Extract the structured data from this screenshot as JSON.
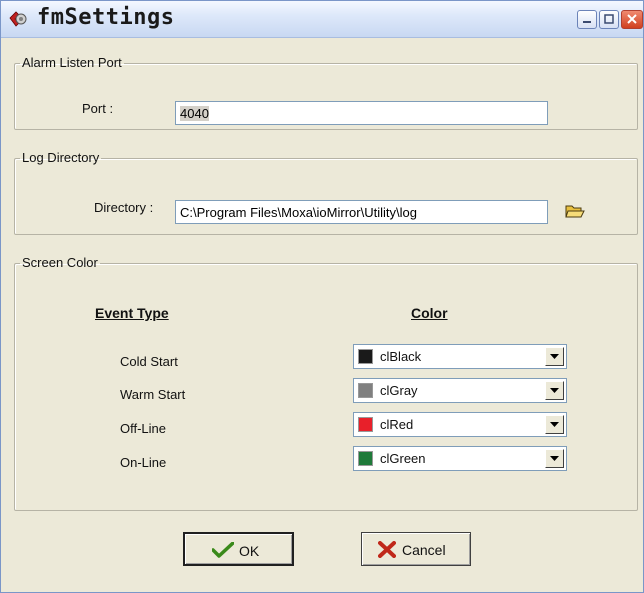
{
  "window": {
    "title": "fmSettings"
  },
  "alarm_group": {
    "legend": "Alarm Listen Port",
    "port_label": "Port :",
    "port_value": "4040"
  },
  "log_group": {
    "legend": "Log Directory",
    "dir_label": "Directory :",
    "dir_value": "C:\\Program Files\\Moxa\\ioMirror\\Utility\\log",
    "folder_icon": "folder-open-icon"
  },
  "color_group": {
    "legend": "Screen Color",
    "event_header": "Event Type",
    "color_header": "Color",
    "rows": [
      {
        "event": "Cold Start",
        "color_name": "clBlack",
        "swatch": "#1a1a1a"
      },
      {
        "event": "Warm Start",
        "color_name": "clGray",
        "swatch": "#808080"
      },
      {
        "event": "Off-Line",
        "color_name": "clRed",
        "swatch": "#e8202a"
      },
      {
        "event": "On-Line",
        "color_name": "clGreen",
        "swatch": "#1f7a3a"
      }
    ]
  },
  "buttons": {
    "ok_label": "OK",
    "cancel_label": "Cancel"
  },
  "colors": {
    "ok_check": "#3a8a1a",
    "cancel_x": "#c0281a",
    "folder": "#e8c040"
  }
}
